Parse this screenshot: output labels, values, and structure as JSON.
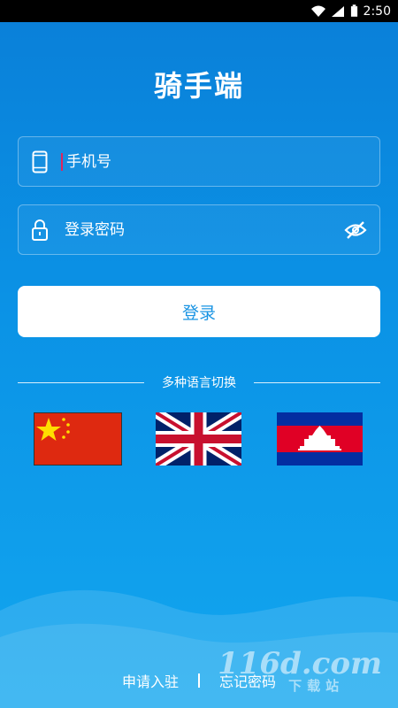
{
  "status_bar": {
    "time": "2:50",
    "icons": [
      "wifi-icon",
      "cell-signal-icon",
      "battery-icon"
    ]
  },
  "app": {
    "title": "骑手端"
  },
  "login_form": {
    "phone_placeholder": "手机号",
    "password_placeholder": "登录密码",
    "login_button": "登录"
  },
  "language": {
    "label": "多种语言切换",
    "options": [
      "chinese-flag",
      "uk-flag",
      "cambodia-flag"
    ]
  },
  "footer": {
    "apply_link": "申请入驻",
    "forgot_link": "忘记密码"
  },
  "watermark": {
    "text": "116d.com",
    "subtext": "下载站"
  },
  "colors": {
    "accent": "#1a94e3",
    "background_top": "#0a7fd8",
    "background_bottom": "#12a6ef"
  }
}
